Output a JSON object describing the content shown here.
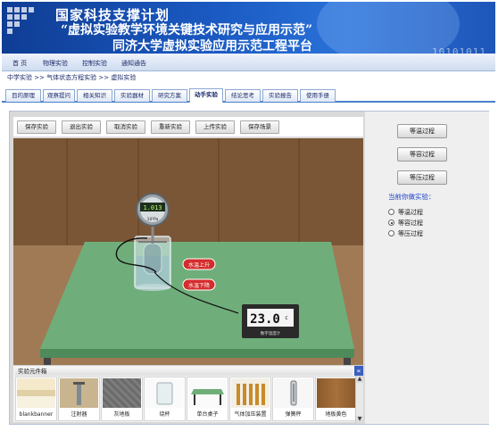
{
  "banner": {
    "title_line1": "国家科技支撑计划",
    "title_line2": "“虚拟实验教学环境关键技术研究与应用示范”",
    "title_line3": "同济大学虚拟实验应用示范工程平台",
    "binary_text": "10101011"
  },
  "main_nav": {
    "items": [
      "首  页",
      "物理实验",
      "控制实验",
      "通知通告"
    ]
  },
  "breadcrumb": {
    "text": "中学实验 >> 气体状态方程实验 >> 虚拟实验"
  },
  "tabs": [
    "目的原理",
    "观察提问",
    "相关知识",
    "实验器材",
    "研究方案",
    "动手实验",
    "结论思考",
    "实验报告",
    "使用手册"
  ],
  "active_tab": "动手实验",
  "toolbar": {
    "buttons": [
      "保存实验",
      "退出实验",
      "取消实验",
      "重新实验",
      "上传实验",
      "保存场景"
    ]
  },
  "scene": {
    "gauge_value": "1.013",
    "gauge_unit": "10⁵Pa",
    "temp_up_label": "水温上升",
    "temp_down_label": "水温下降",
    "thermometer_value": "23.0",
    "thermometer_unit": "c",
    "thermometer_label": "数字温度计"
  },
  "component_library": {
    "title": "实验元件箱",
    "collapse_icon": "«",
    "items": [
      "blankbanner",
      "注射器",
      "灰地板",
      "烧杯",
      "单台桌子",
      "气体加压装置",
      "弹簧秤",
      "地板黄色"
    ]
  },
  "right_panel": {
    "buttons": [
      "等温过程",
      "等容过程",
      "等压过程"
    ],
    "current_label": "当前你做实验：",
    "options": [
      "等温过程",
      "等容过程",
      "等压过程"
    ],
    "selected_option": "等容过程"
  }
}
